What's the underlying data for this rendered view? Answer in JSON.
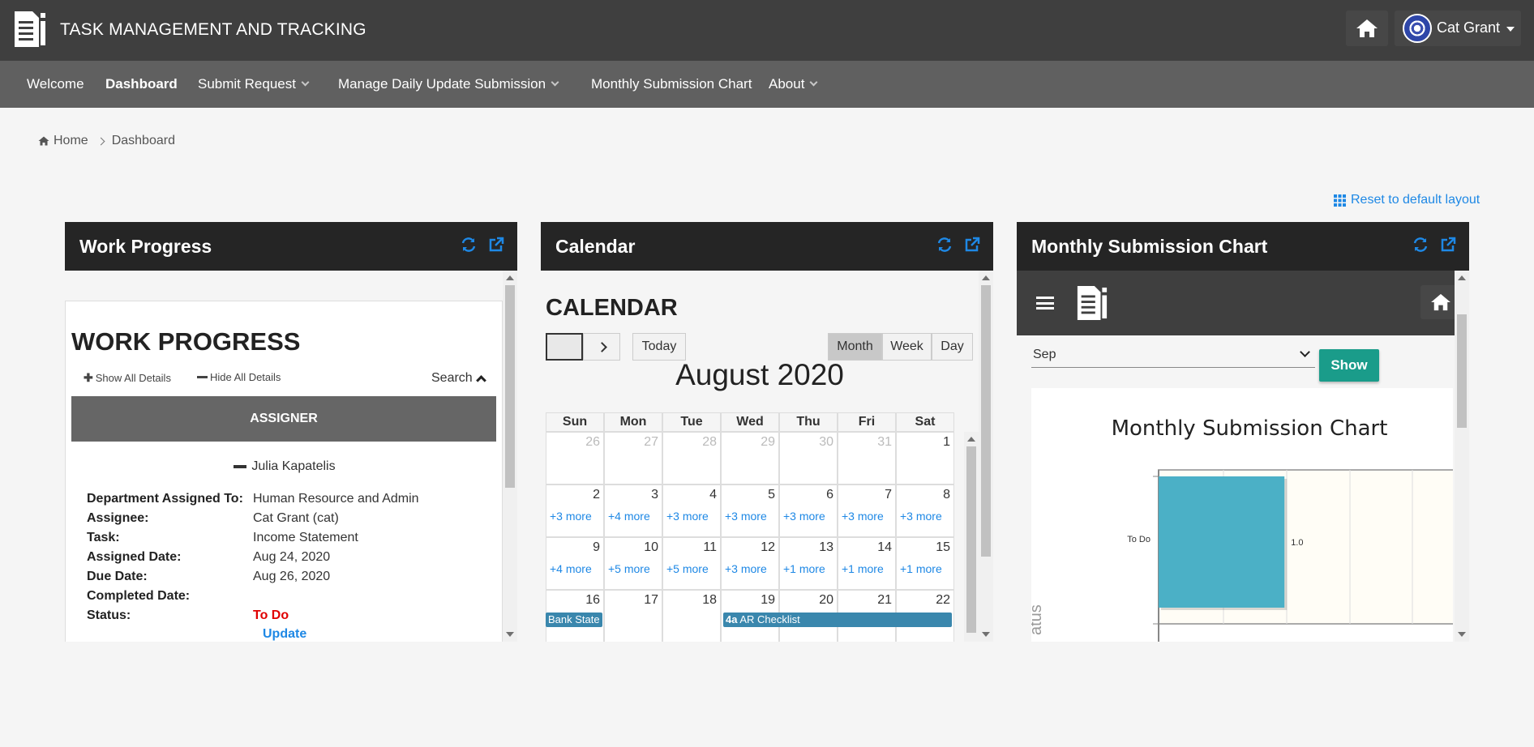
{
  "app": {
    "title": "TASK MANAGEMENT AND TRACKING",
    "user_name": "Cat Grant"
  },
  "nav": {
    "items": [
      {
        "label": "Welcome"
      },
      {
        "label": "Dashboard"
      },
      {
        "label": "Submit Request"
      },
      {
        "label": "Manage Daily Update Submission"
      },
      {
        "label": "Monthly Submission Chart"
      },
      {
        "label": "About"
      }
    ]
  },
  "breadcrumb": {
    "home": "Home",
    "current": "Dashboard"
  },
  "reset_link": "Reset to default layout",
  "panels": {
    "work_progress": {
      "title": "Work Progress",
      "heading": "WORK PROGRESS",
      "show_all": "Show All Details",
      "hide_all": "Hide All Details",
      "search": "Search",
      "assigner_header": "ASSIGNER",
      "assigner_name": "Julia Kapatelis",
      "fields": [
        {
          "key": "Department Assigned To:",
          "value": "Human Resource and Admin"
        },
        {
          "key": "Assignee:",
          "value": "Cat Grant (cat)"
        },
        {
          "key": "Task:",
          "value": "Income Statement"
        },
        {
          "key": "Assigned Date:",
          "value": "Aug 24, 2020"
        },
        {
          "key": "Due Date:",
          "value": "Aug 26, 2020"
        },
        {
          "key": "Completed Date:",
          "value": ""
        },
        {
          "key": "Status:",
          "value": "To Do"
        }
      ],
      "update_link": "Update",
      "status_color": "#e00000"
    },
    "calendar": {
      "title": "Calendar",
      "heading": "CALENDAR",
      "today": "Today",
      "views": [
        "Month",
        "Week",
        "Day"
      ],
      "month_label": "August 2020",
      "weekdays": [
        "Sun",
        "Mon",
        "Tue",
        "Wed",
        "Thu",
        "Fri",
        "Sat"
      ],
      "weeks": [
        [
          {
            "n": "26",
            "dim": true
          },
          {
            "n": "27",
            "dim": true
          },
          {
            "n": "28",
            "dim": true
          },
          {
            "n": "29",
            "dim": true
          },
          {
            "n": "30",
            "dim": true
          },
          {
            "n": "31",
            "dim": true
          },
          {
            "n": "1"
          }
        ],
        [
          {
            "n": "2",
            "more": "+3 more"
          },
          {
            "n": "3",
            "more": "+4 more"
          },
          {
            "n": "4",
            "more": "+3 more"
          },
          {
            "n": "5",
            "more": "+3 more"
          },
          {
            "n": "6",
            "more": "+3 more"
          },
          {
            "n": "7",
            "more": "+3 more"
          },
          {
            "n": "8",
            "more": "+3 more"
          }
        ],
        [
          {
            "n": "9",
            "more": "+4 more"
          },
          {
            "n": "10",
            "more": "+5 more"
          },
          {
            "n": "11",
            "more": "+5 more"
          },
          {
            "n": "12",
            "more": "+3 more"
          },
          {
            "n": "13",
            "more": "+1 more"
          },
          {
            "n": "14",
            "more": "+1 more"
          },
          {
            "n": "15",
            "more": "+1 more"
          }
        ],
        [
          {
            "n": "16"
          },
          {
            "n": "17"
          },
          {
            "n": "18"
          },
          {
            "n": "19"
          },
          {
            "n": "20"
          },
          {
            "n": "21"
          },
          {
            "n": "22"
          }
        ]
      ],
      "events": [
        {
          "label": "Bank State",
          "time": ""
        },
        {
          "label": "AR Checklist",
          "time": "4a"
        }
      ]
    },
    "monthly_chart": {
      "title": "Monthly Submission Chart",
      "month_select": "Sep",
      "show_button": "Show"
    }
  },
  "chart_data": {
    "type": "bar",
    "orientation": "horizontal",
    "title": "Monthly Submission Chart",
    "categories": [
      "To Do"
    ],
    "values": [
      1.0
    ],
    "value_labels": [
      "1.0"
    ],
    "ylabel": "Status (partially visible)",
    "bar_color": "#4bb0c6",
    "plot_background": "#fffdf6"
  },
  "colors": {
    "accent": "#1e88e5",
    "topbar": "#3f3f3f",
    "navbar": "#606060",
    "teal": "#1a9c8a"
  }
}
